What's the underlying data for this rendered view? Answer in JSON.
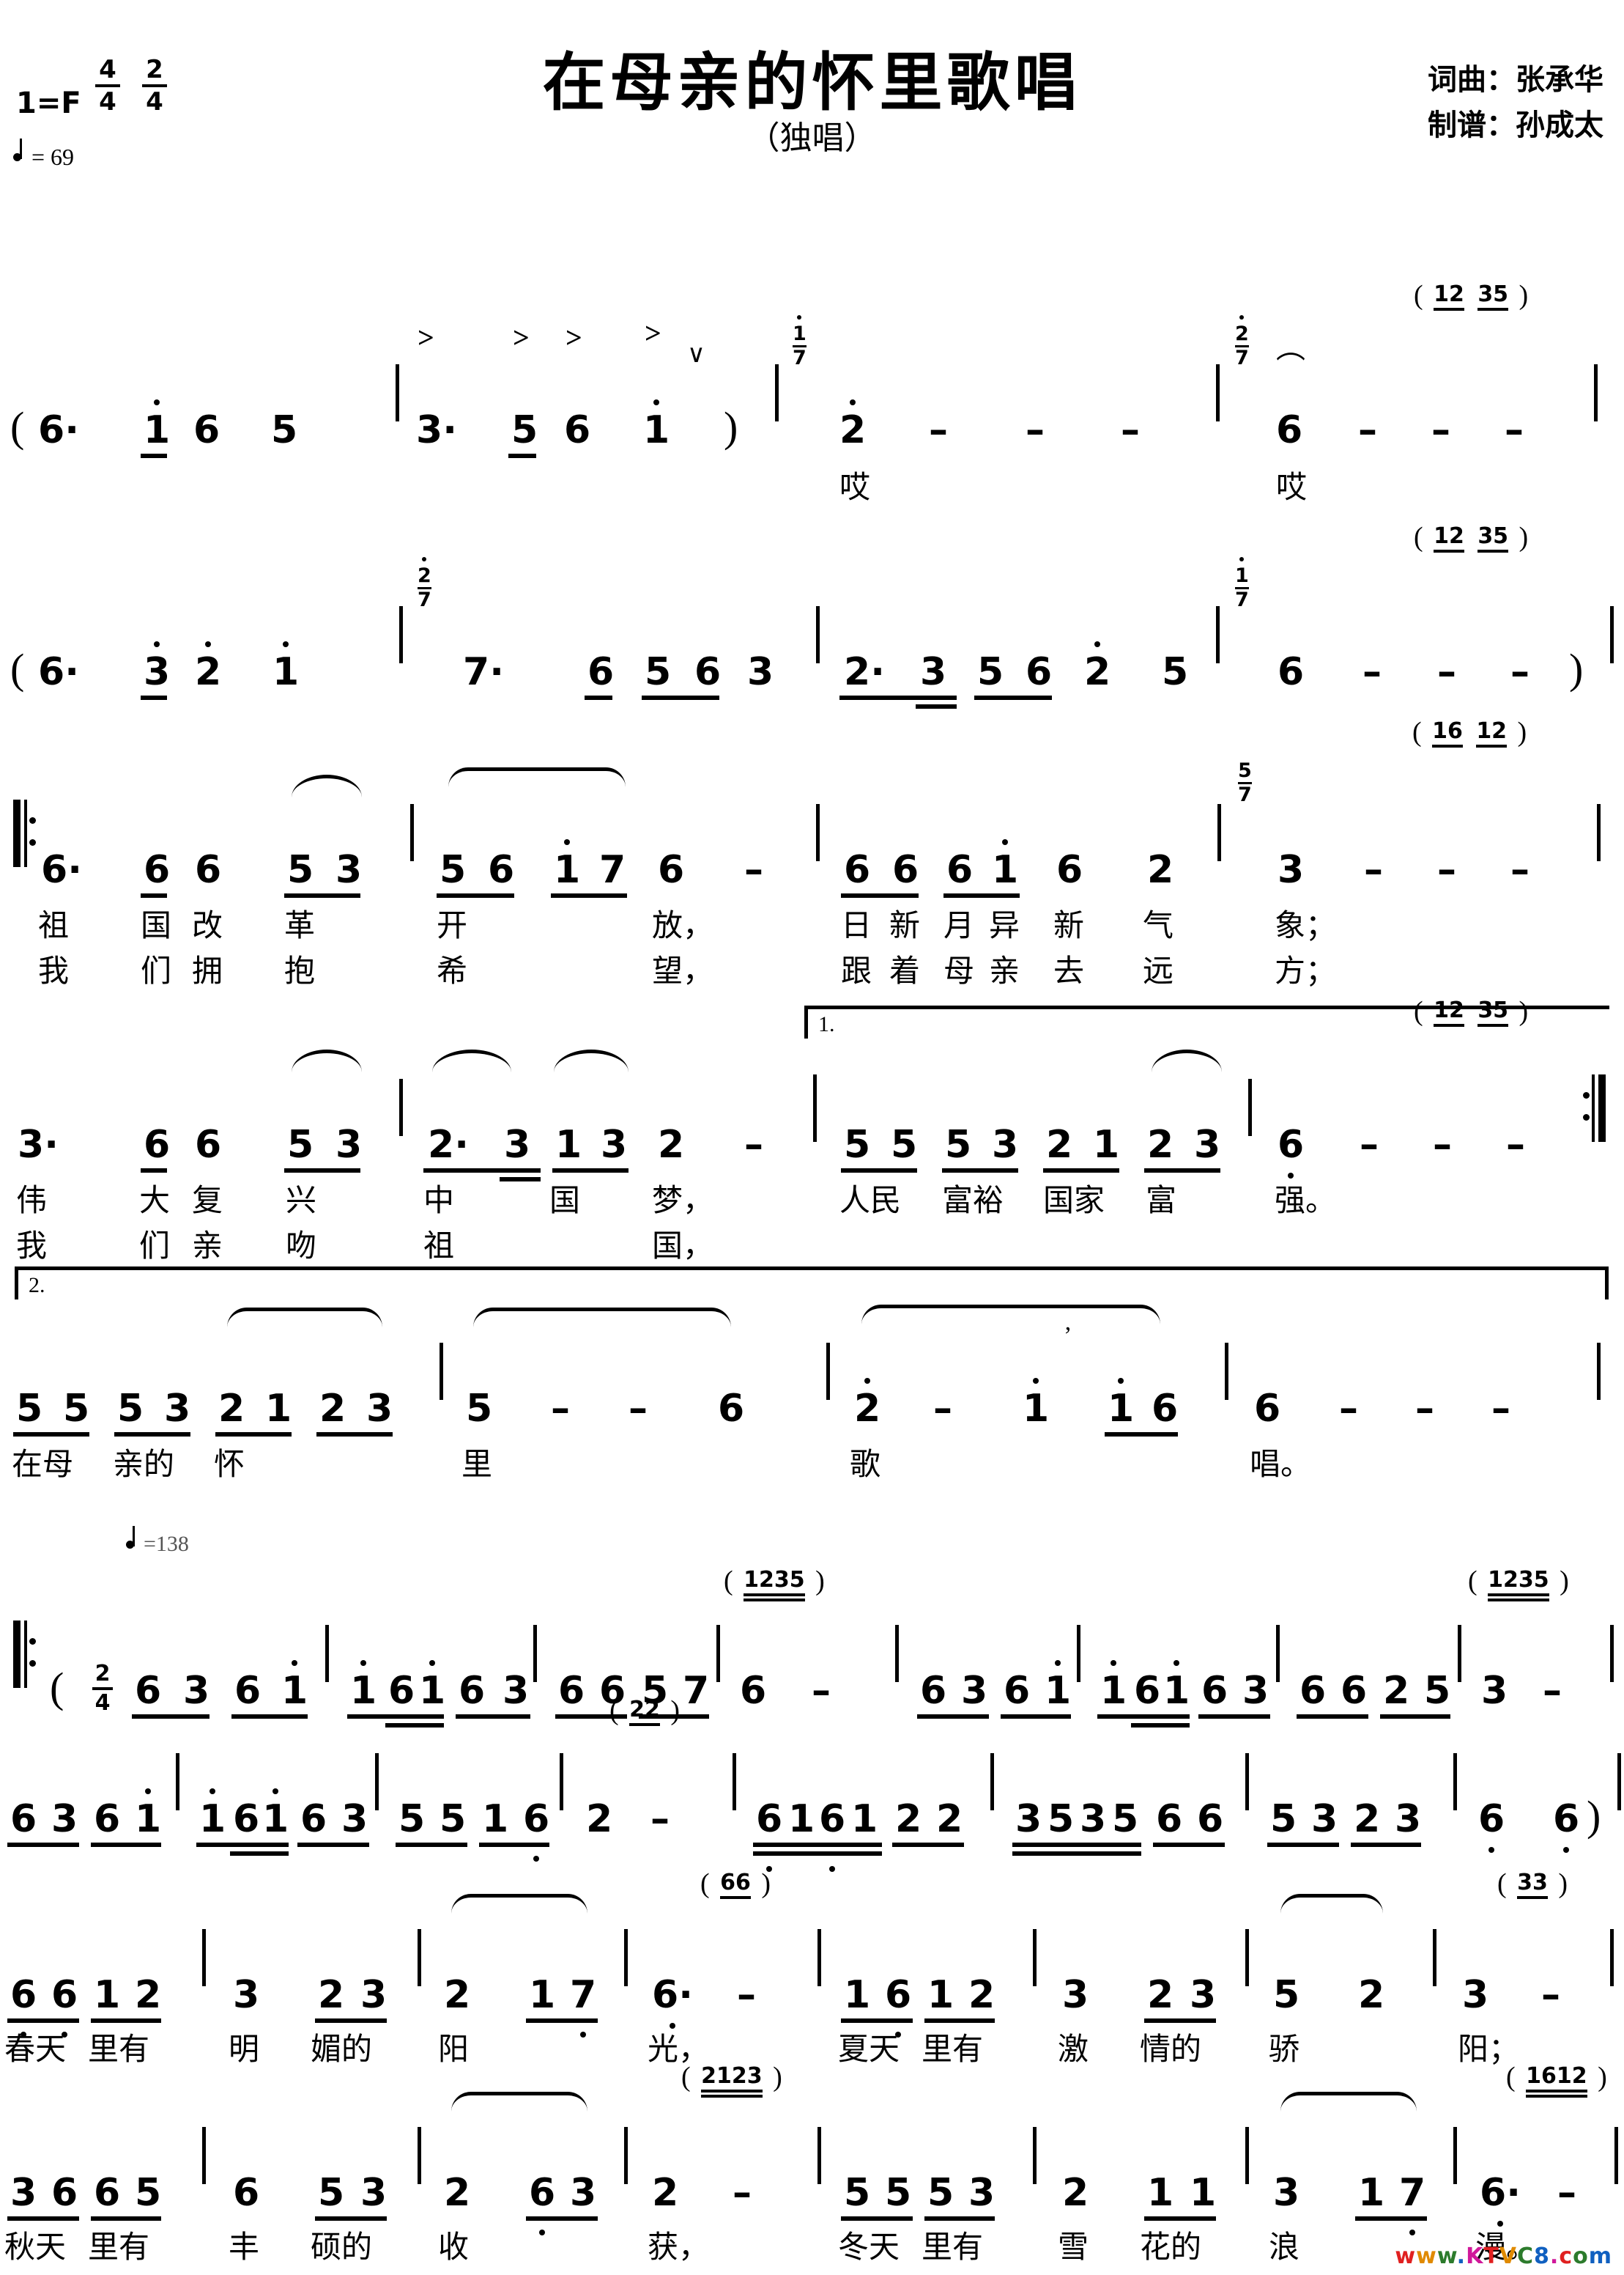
{
  "header": {
    "title": "在母亲的怀里歌唱",
    "subtitle": "（独唱）",
    "key_signature": "1=F",
    "meters": [
      {
        "num": "4",
        "den": "4"
      },
      {
        "num": "2",
        "den": "4"
      }
    ],
    "tempo_1": "= 69",
    "tempo_2": "=138",
    "credit_lyrics_music": "词曲：张承华",
    "credit_engraver": "制谱：孙成太"
  },
  "watermark": "www.KTVC8.com",
  "score": {
    "line1": {
      "notes": [
        "( 6·",
        "1̇",
        "6",
        "5",
        "3·",
        "5",
        "6",
        "1̇",
        ")",
        "2̇",
        "—",
        "—",
        "—",
        "6̇",
        "—",
        "—",
        "—"
      ],
      "grace": "( 12  35 )",
      "appoggiatura_1": "1̇/7",
      "appoggiatura_2": "2̇/7",
      "lyrics": [
        "哎",
        "哎"
      ],
      "accents": [
        ">",
        ">",
        ">",
        ">"
      ],
      "breath_mark": "∨"
    },
    "line2": {
      "notes": [
        "( 6·",
        "3̇",
        "2̇",
        "1̇",
        "7·",
        "6",
        "5",
        "6",
        "3",
        "2·",
        "3",
        "5",
        "6",
        "2̇",
        "5",
        "6",
        "—",
        "—",
        "—",
        ")"
      ],
      "grace": "( 12  35 )",
      "appoggiatura_1": "2̇/7",
      "appoggiatura_2": "1̇/7"
    },
    "line3": {
      "notes": [
        "6·",
        "6",
        "6",
        "5",
        "3",
        "5",
        "6",
        "1̇",
        "7",
        "6",
        "—",
        "6",
        "6",
        "6",
        "1̇",
        "6",
        "2",
        "3",
        "—",
        "—",
        "—"
      ],
      "grace": "( 16  12 )",
      "appoggiatura": "5/7",
      "lyrics_v1": [
        "祖",
        "国",
        "改",
        "革",
        "开",
        "放，",
        "日",
        "新",
        "月",
        "异",
        "新",
        "气",
        "象；"
      ],
      "lyrics_v2": [
        "我",
        "们",
        "拥",
        "抱",
        "希",
        "望，",
        "跟",
        "着",
        "母",
        "亲",
        "去",
        "远",
        "方；"
      ]
    },
    "line4": {
      "notes": [
        "3·",
        "6",
        "6",
        "5",
        "3",
        "2·",
        "3",
        "1",
        "3",
        "2",
        "—",
        "5",
        "5",
        "5",
        "3",
        "2",
        "1",
        "2",
        "3",
        "6̣",
        "—",
        "—",
        "—"
      ],
      "grace": "( 12  35 )",
      "volta": "1.",
      "lyrics_v1": [
        "伟",
        "大",
        "复",
        "兴",
        "中",
        "国",
        "梦，",
        "人民",
        "富裕",
        "国家",
        "富",
        "强。"
      ],
      "lyrics_v2": [
        "我",
        "们",
        "亲",
        "吻",
        "祖",
        "国，"
      ]
    },
    "line5": {
      "notes": [
        "5",
        "5",
        "5",
        "3",
        "2",
        "1",
        "2",
        "3",
        "5",
        "—",
        "—",
        "6",
        "2̇",
        "—",
        "1̇",
        "’",
        "1̇",
        "6",
        "6",
        "—",
        "—",
        "—"
      ],
      "volta": "2.",
      "lyrics": [
        "在母",
        "亲的",
        "怀",
        "里",
        "歌",
        "唱。"
      ]
    },
    "line6": {
      "notes": [
        "( 2/4",
        "6",
        "3",
        "6",
        "1̇",
        "1̇",
        "6",
        "1̇",
        "6",
        "3",
        "6",
        "6",
        "5",
        "7",
        "6",
        "—",
        "6",
        "3",
        "6",
        "1̇",
        "1̇",
        "6",
        "1̇",
        "6",
        "3",
        "6",
        "6",
        "2",
        "5",
        "3"
      ],
      "grace_1": "( 1235 )",
      "grace_2": "( 1235 )"
    },
    "line7": {
      "notes": [
        "6",
        "3",
        "6",
        "1̇",
        "1̇",
        "6",
        "1̇",
        "6",
        "3",
        "5",
        "5",
        "1",
        "6̣",
        "2",
        "—",
        "6̣",
        "1",
        "6̣",
        "1",
        "2",
        "2",
        "3",
        "5",
        "3",
        "5",
        "6",
        "6",
        "5",
        "3",
        "2",
        "3",
        "6̣",
        "6̣",
        ")"
      ],
      "grace": "( 22 )"
    },
    "line8": {
      "notes": [
        "6̣",
        "6̣",
        "1",
        "2",
        "3",
        "2",
        "3",
        "2",
        "1",
        "7̣",
        "6̣·",
        "—",
        "1",
        "6̣",
        "1",
        "2",
        "3",
        "2",
        "3",
        "5",
        "2",
        "3",
        "—"
      ],
      "grace_1": "( 66 )",
      "grace_2": "( 33 )",
      "lyrics": [
        "春天",
        "里有",
        "明",
        "媚的",
        "阳",
        "光，",
        "夏天",
        "里有",
        "激",
        "情的",
        "骄",
        "阳；"
      ]
    },
    "line9": {
      "notes": [
        "3",
        "6",
        "6",
        "5",
        "6",
        "5",
        "3",
        "2",
        "6̣",
        "3",
        "2",
        "—",
        "5",
        "5",
        "5",
        "3",
        "2",
        "1",
        "1",
        "3",
        "1",
        "7̣",
        "6̣·",
        "—"
      ],
      "grace_1": "( 2123 )",
      "grace_2": "( 1612 )",
      "lyrics": [
        "秋天",
        "里有",
        "丰",
        "硕的",
        "收",
        "获，",
        "冬天",
        "里有",
        "雪",
        "花的",
        "浪",
        "漫。"
      ]
    }
  }
}
